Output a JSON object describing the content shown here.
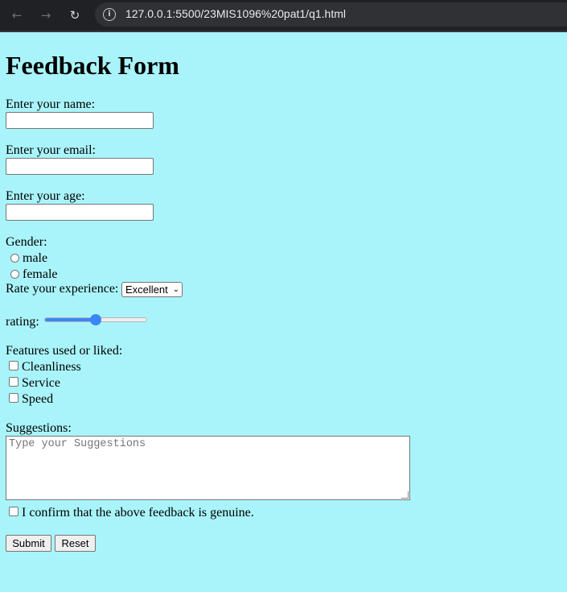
{
  "browser": {
    "url": "127.0.0.1:5500/23MIS1096%20pat1/q1.html",
    "back_icon": "arrow-left-icon",
    "forward_icon": "arrow-right-icon",
    "reload_icon": "reload-icon",
    "info_icon": "info-icon"
  },
  "page": {
    "background": "#a9f4fa",
    "title": "Feedback Form",
    "name_label": "Enter your name:",
    "name_value": "",
    "email_label": "Enter your email:",
    "email_value": "",
    "age_label": "Enter your age:",
    "age_value": "",
    "gender_label": "Gender:",
    "gender_options": [
      "male",
      "female"
    ],
    "experience_label": "Rate your experience:",
    "experience_selected": "Excellent",
    "rating_label": "rating:",
    "rating_fraction": 0.5,
    "features_label": "Features used or liked:",
    "features": [
      "Cleanliness",
      "Service",
      "Speed"
    ],
    "suggestions_label": "Suggestions:",
    "suggestions_placeholder": "Type your Suggestions",
    "confirm_label": "I confirm that the above feedback is genuine.",
    "submit_label": "Submit",
    "reset_label": "Reset",
    "accent_color": "#3a86f6"
  }
}
